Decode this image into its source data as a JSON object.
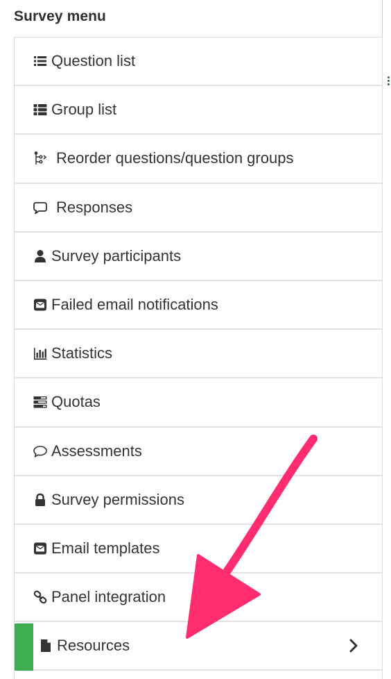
{
  "panel": {
    "title": "Survey menu"
  },
  "menu": {
    "items": [
      {
        "label": "Question list",
        "icon": "list-icon"
      },
      {
        "label": "Group list",
        "icon": "th-list-icon"
      },
      {
        "label": "Reorder questions/question groups",
        "icon": "reorder-icon"
      },
      {
        "label": "Responses",
        "icon": "comment-outline-icon"
      },
      {
        "label": "Survey participants",
        "icon": "user-icon"
      },
      {
        "label": "Failed email notifications",
        "icon": "envelope-square-icon"
      },
      {
        "label": "Statistics",
        "icon": "bar-chart-icon"
      },
      {
        "label": "Quotas",
        "icon": "tasks-icon"
      },
      {
        "label": "Assessments",
        "icon": "comment-o-icon"
      },
      {
        "label": "Survey permissions",
        "icon": "lock-icon"
      },
      {
        "label": "Email templates",
        "icon": "envelope-square-icon"
      },
      {
        "label": "Panel integration",
        "icon": "link-icon"
      },
      {
        "label": "Resources",
        "icon": "file-icon",
        "active": true
      }
    ]
  },
  "colors": {
    "active_bar": "#3eaf4f",
    "annotation_arrow": "#ff2d6f",
    "text": "#333333"
  }
}
